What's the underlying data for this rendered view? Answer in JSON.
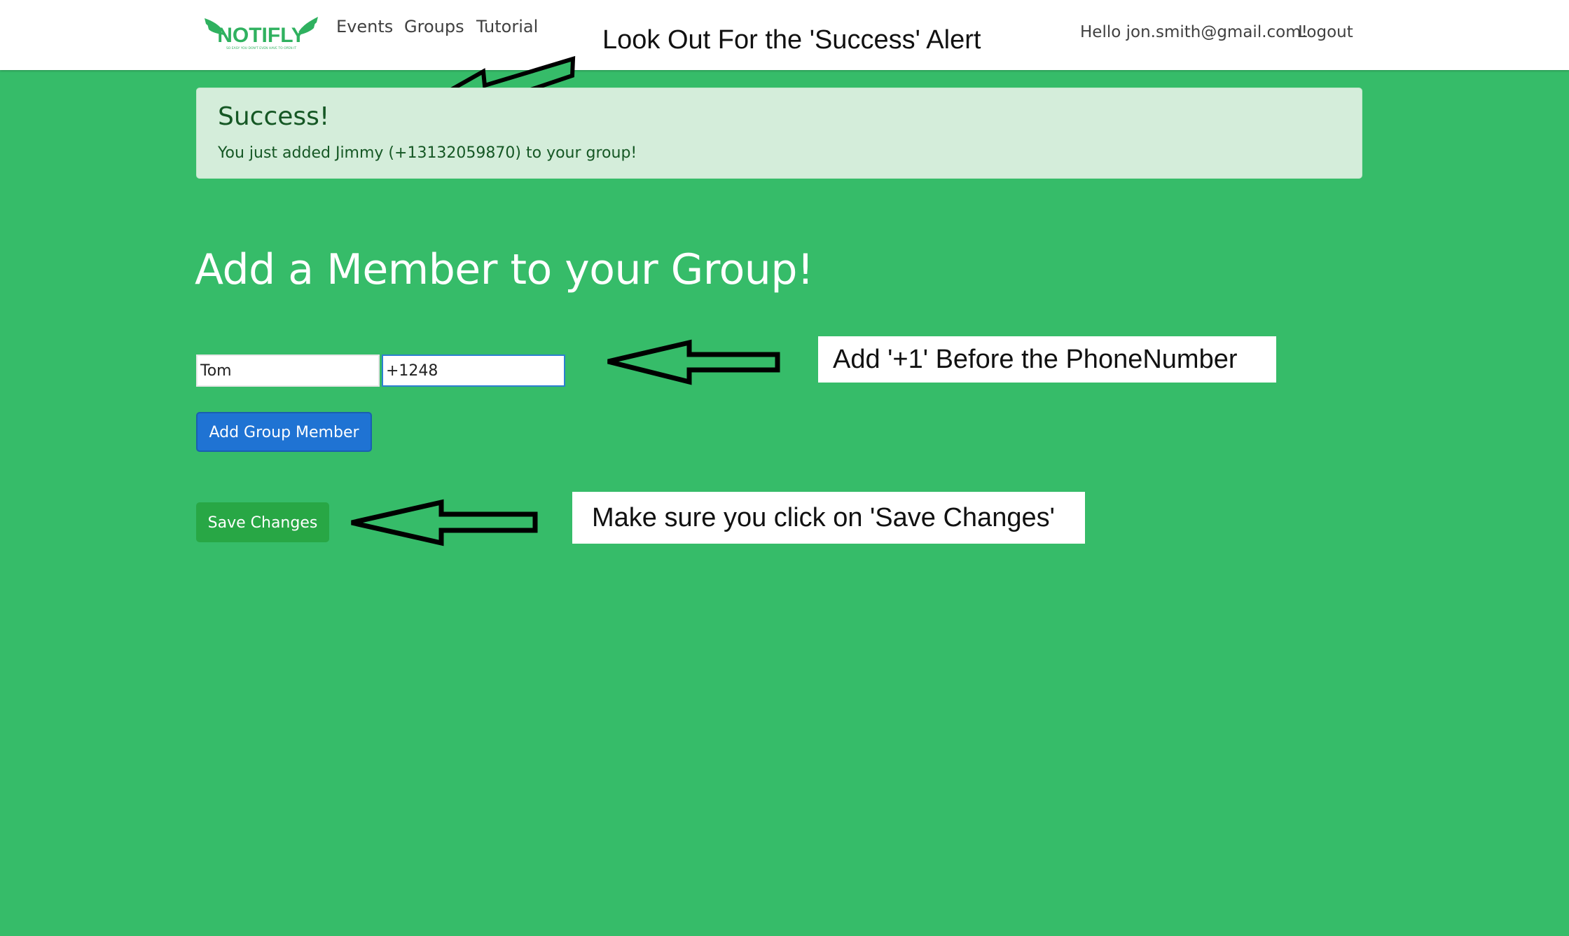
{
  "navbar": {
    "brand": "NOTIFLY",
    "brand_tagline": "SO EASY YOU DON'T EVEN HAVE TO OPEN IT",
    "links": [
      "Events",
      "Groups",
      "Tutorial"
    ],
    "greeting": "Hello jon.smith@gmail.com!",
    "logout": "Logout"
  },
  "annotations": {
    "top": "Look Out For the 'Success' Alert",
    "phone": "Add '+1' Before the PhoneNumber",
    "save": "Make sure you click on 'Save Changes'"
  },
  "alert": {
    "heading": "Success!",
    "message": "You just added Jimmy (+13132059870) to your group!"
  },
  "main": {
    "title": "Add a Member to your Group!",
    "name_value": "Tom",
    "phone_value": "+1248",
    "add_button": "Add Group Member",
    "save_button": "Save Changes"
  },
  "colors": {
    "background": "#36bc69",
    "alert_bg": "#d4edda",
    "alert_text": "#155724",
    "primary": "#1f73d3",
    "success": "#28a745",
    "logo": "#2fb15f"
  }
}
